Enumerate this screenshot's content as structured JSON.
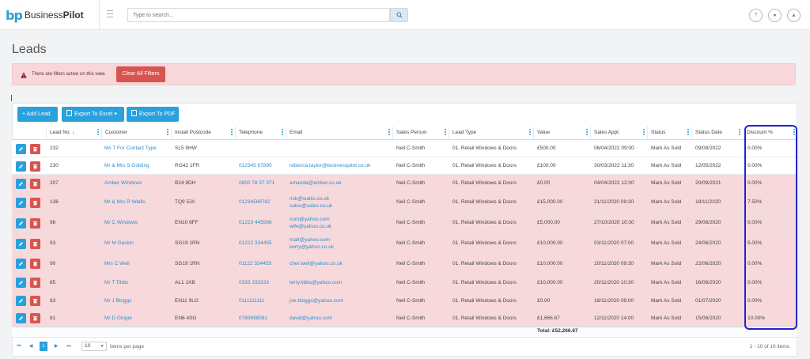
{
  "app": {
    "logo_mark": "bp",
    "logo_name_1": "Business",
    "logo_name_2": "Pilot"
  },
  "search": {
    "placeholder": "Type to search..."
  },
  "header_icons": [
    "help-icon",
    "user-icon",
    "bell-icon"
  ],
  "header_icon_glyphs": [
    "?",
    "●",
    "▲"
  ],
  "page": {
    "title": "Leads"
  },
  "alert": {
    "text": "There are filters active on this view.",
    "clear_label": "Clear All Filters"
  },
  "toolbar": {
    "add_label": "+ Add Lead",
    "export_excel_label": "Export To Excel ▾",
    "export_pdf_label": "Export To PDF"
  },
  "columns": [
    "Lead No. ↓",
    "Customer",
    "Install Postcode",
    "Telephone",
    "Email",
    "Sales Person",
    "Lead Type",
    "Value",
    "Sales Appt",
    "Status",
    "Status Date",
    "Discount %"
  ],
  "rows": [
    {
      "lead_no": "232",
      "customer": "Ms T For Contact Type",
      "postcode": "SL5 9HW",
      "telephone": "",
      "email": "",
      "email2": "",
      "sales_person": "Neil C-Smith",
      "lead_type": "01. Retail Windows & Doors",
      "value": "£500.00",
      "sales_appt": "06/04/2022 09:00",
      "status": "Mark As Sold",
      "status_date": "09/08/2022",
      "discount": "0.00%"
    },
    {
      "lead_no": "230",
      "customer": "Mr & Mrs S Golding",
      "postcode": "RG42 1FR",
      "telephone": "012345 67890",
      "email": "rebecca.taylor@businesspilot.co.uk",
      "email2": "",
      "sales_person": "Neil C-Smith",
      "lead_type": "01. Retail Windows & Doors",
      "value": "£100.00",
      "sales_appt": "30/03/2022 11:30",
      "status": "Mark As Sold",
      "status_date": "12/05/2022",
      "discount": "0.00%"
    },
    {
      "lead_no": "207",
      "customer": "Amber Windows",
      "postcode": "B24 9DH",
      "telephone": "0800 78 37 371",
      "email": "amanda@amber.co.uk",
      "email2": "",
      "sales_person": "Neil C-Smith",
      "lead_type": "01. Retail Windows & Doors",
      "value": "£0.00",
      "sales_appt": "04/04/2022 12:00",
      "status": "Mark As Sold",
      "status_date": "20/09/2021",
      "discount": "0.00%"
    },
    {
      "lead_no": "136",
      "customer": "Mr & Mrs R Wallis",
      "postcode": "TQ9 5JA",
      "telephone": "01234569782",
      "email": "rick@wallis.co.uk",
      "email2": "sales@sales.co.uk",
      "sales_person": "Neil C-Smith",
      "lead_type": "01. Retail Windows & Doors",
      "value": "£15,000.00",
      "sales_appt": "21/11/2020 09:30",
      "status": "Mark As Sold",
      "status_date": "18/11/2020",
      "discount": "7.50%"
    },
    {
      "lead_no": "96",
      "customer": "Mr C Windows",
      "postcode": "EN10 6FF",
      "telephone": "01223 445566",
      "email": "com@yahoo.com",
      "email2": "wife@yahoo.co.uk",
      "sales_person": "Neil C-Smith",
      "lead_type": "01. Retail Windows & Doors",
      "value": "£5,000.00",
      "sales_appt": "27/10/2020 10:30",
      "status": "Mark As Sold",
      "status_date": "29/06/2020",
      "discount": "0.00%"
    },
    {
      "lead_no": "93",
      "customer": "Mr M Gaskin",
      "postcode": "SG19 1RN",
      "telephone": "01222 334455",
      "email": "matt@yahoo.com",
      "email2": "kerry@yahoo.co.uk",
      "sales_person": "Neil C-Smith",
      "lead_type": "01. Retail Windows & Doors",
      "value": "£10,000.00",
      "sales_appt": "03/11/2020 07:00",
      "status": "Mark As Sold",
      "status_date": "24/06/2020",
      "discount": "5.00%"
    },
    {
      "lead_no": "90",
      "customer": "Mrs C Well",
      "postcode": "SG19 1RN",
      "telephone": "01122 334455",
      "email": "cher.well@yahoo.co.uk",
      "email2": "",
      "sales_person": "Neil C-Smith",
      "lead_type": "01. Retail Windows & Doors",
      "value": "£10,000.00",
      "sales_appt": "10/11/2020 09:30",
      "status": "Mark As Sold",
      "status_date": "22/06/2020",
      "discount": "0.00%"
    },
    {
      "lead_no": "85",
      "customer": "Mr T Tibbs",
      "postcode": "AL1 1XB",
      "telephone": "0333 333333",
      "email": "terry.tibbs@yahoo.com",
      "email2": "",
      "sales_person": "Neil C-Smith",
      "lead_type": "01. Retail Windows & Doors",
      "value": "£10,000.00",
      "sales_appt": "20/11/2020 10:30",
      "status": "Mark As Sold",
      "status_date": "16/06/2020",
      "discount": "0.00%"
    },
    {
      "lead_no": "83",
      "customer": "Mr J Bloggs",
      "postcode": "EN11 9LG",
      "telephone": "0111111111",
      "email": "joe.bloggs@yahoo.com",
      "email2": "",
      "sales_person": "Neil C-Smith",
      "lead_type": "01. Retail Windows & Doors",
      "value": "£0.00",
      "sales_appt": "18/11/2020 09:00",
      "status": "Mark As Sold",
      "status_date": "01/07/2020",
      "discount": "0.00%"
    },
    {
      "lead_no": "81",
      "customer": "Mr D Ginger",
      "postcode": "EN6 4SG",
      "telephone": "0789898091",
      "email": "david@yahoo.com",
      "email2": "",
      "sales_person": "Neil C-Smith",
      "lead_type": "01. Retail Windows & Doors",
      "value": "£1,666.67",
      "sales_appt": "12/11/2020 14:00",
      "status": "Mark As Sold",
      "status_date": "15/06/2020",
      "discount": "10.00%"
    }
  ],
  "row_highlight": [
    "white",
    "white",
    "pink",
    "pink",
    "pink",
    "pink",
    "pink",
    "pink",
    "pink",
    "pink"
  ],
  "totals": {
    "value_total": "Total: £52,266.67"
  },
  "pager": {
    "first_glyph": "⏮",
    "prev_glyph": "◀",
    "current_page": "1",
    "next_glyph": "▶",
    "last_glyph": "⏭",
    "per_page": "10",
    "per_page_label": "items per page",
    "summary": "1 - 10 of 10 items"
  },
  "colors": {
    "accent": "#2aa0dc",
    "danger": "#d9534f",
    "filtered_row": "#f7d9dc",
    "highlight_box": "#2222cc"
  }
}
